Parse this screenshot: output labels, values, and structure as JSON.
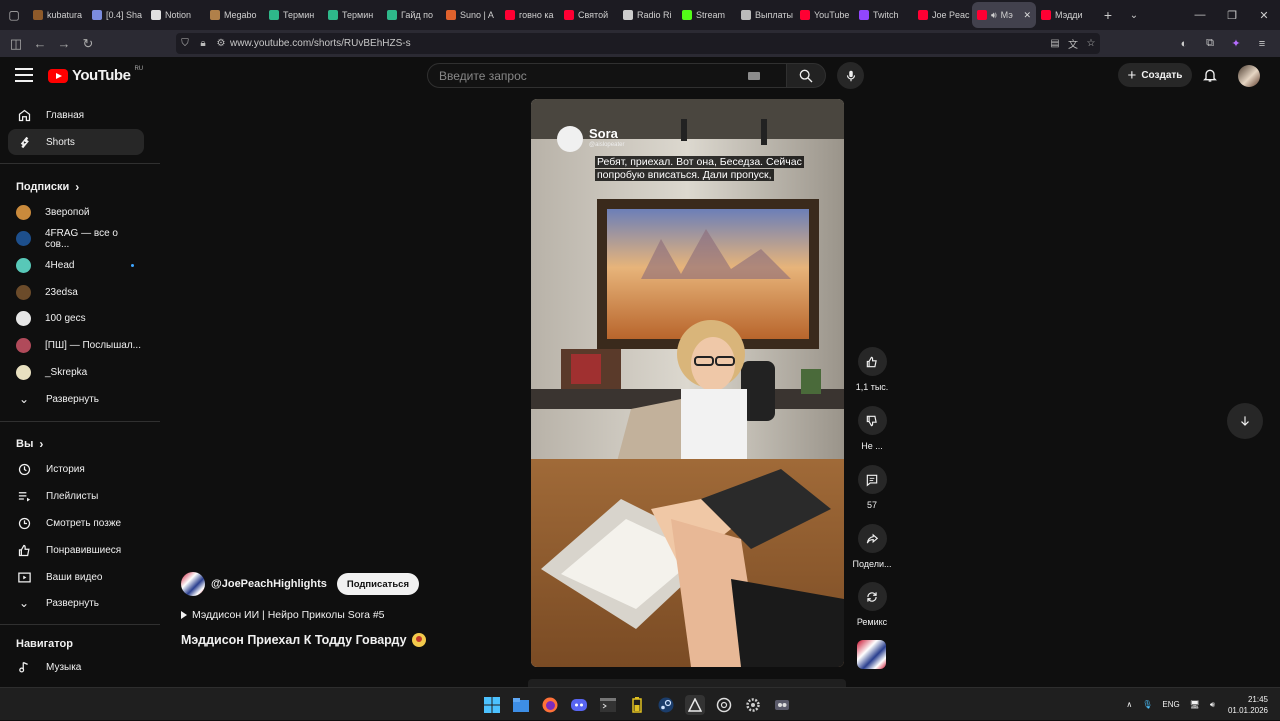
{
  "browser": {
    "tabs": [
      {
        "label": "kubatura",
        "color": "#8e5a2a"
      },
      {
        "label": "[0.4] Sha",
        "color": "#7b8cde"
      },
      {
        "label": "Notion",
        "color": "#e0e0e0"
      },
      {
        "label": "Megabo",
        "color": "#b0804a"
      },
      {
        "label": "Термин",
        "color": "#2eb88a"
      },
      {
        "label": "Термин",
        "color": "#2eb88a"
      },
      {
        "label": "Гайд по",
        "color": "#2eb88a"
      },
      {
        "label": "Suno | A",
        "color": "#e0622d"
      },
      {
        "label": "говно ка",
        "color": "#ff0033"
      },
      {
        "label": "Святой",
        "color": "#ff0033"
      },
      {
        "label": "Radio Ri",
        "color": "#cccccc"
      },
      {
        "label": "Stream",
        "color": "#53fc18"
      },
      {
        "label": "Выплаты",
        "color": "#bbbbbb"
      },
      {
        "label": "YouTube",
        "color": "#ff0033"
      },
      {
        "label": "Twitch",
        "color": "#9146ff"
      },
      {
        "label": "Joe Peac",
        "color": "#ff0033"
      },
      {
        "label": "Мэ",
        "color": "#ff0033",
        "active": true
      },
      {
        "label": "Мэдди",
        "color": "#ff0033"
      }
    ],
    "url": "www.youtube.com/shorts/RUvBEhHZS-s"
  },
  "masthead": {
    "logo_text": "YouTube",
    "region": "RU",
    "search_placeholder": "Введите запрос",
    "create_label": "Создать"
  },
  "sidebar": {
    "main": [
      {
        "label": "Главная",
        "icon": "home-icon"
      },
      {
        "label": "Shorts",
        "icon": "shorts-icon",
        "selected": true
      }
    ],
    "subscriptions_title": "Подписки",
    "subscriptions": [
      {
        "label": "Зверопой",
        "color": "#c98a3c"
      },
      {
        "label": "4FRAG — все о сов...",
        "color": "#1d4f8c"
      },
      {
        "label": "4Head",
        "color": "#58c8b8",
        "new": true
      },
      {
        "label": "23edsa",
        "color": "#6b4b2a"
      },
      {
        "label": "100 gecs",
        "color": "#e6e6e6"
      },
      {
        "label": "[ПШ] — Послышал...",
        "color": "#b04a5a"
      },
      {
        "label": "_Skrepka",
        "color": "#e8e0c0"
      }
    ],
    "expand_label": "Развернуть",
    "you_title": "Вы",
    "you_items": [
      {
        "label": "История",
        "icon": "history-icon"
      },
      {
        "label": "Плейлисты",
        "icon": "playlists-icon"
      },
      {
        "label": "Смотреть позже",
        "icon": "watch-later-icon"
      },
      {
        "label": "Понравившиеся",
        "icon": "liked-icon"
      },
      {
        "label": "Ваши видео",
        "icon": "your-videos-icon"
      }
    ],
    "expand_label_2": "Развернуть",
    "navigator_title": "Навигатор",
    "navigator_items": [
      {
        "label": "Музыка",
        "icon": "music-icon"
      }
    ]
  },
  "short": {
    "watermark_name": "Sora",
    "watermark_handle": "@aislopeater",
    "caption": "Ребят, приехал. Вот она, Беседза. Сейчас попробую вписаться. Дали пропуск,",
    "channel": "@JoePeachHighlights",
    "subscribe_label": "Подписаться",
    "playlist": "Мэддисон ИИ | Нейро Приколы Sora #5",
    "title": "Мэддисон Приехал К Тодду Говарду"
  },
  "actions": {
    "likes": "1,1 тыс.",
    "dislike": "Не ...",
    "comments": "57",
    "share": "Подели...",
    "remix": "Ремикс"
  },
  "taskbar": {
    "lang": "ENG",
    "time": "21:45",
    "date": "01.01.2026"
  }
}
